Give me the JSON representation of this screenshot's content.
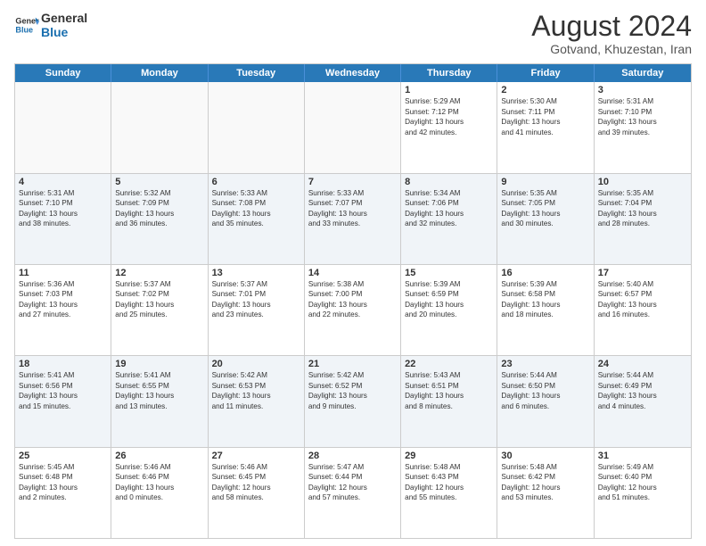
{
  "logo": {
    "line1": "General",
    "line2": "Blue"
  },
  "title": "August 2024",
  "location": "Gotvand, Khuzestan, Iran",
  "days": [
    "Sunday",
    "Monday",
    "Tuesday",
    "Wednesday",
    "Thursday",
    "Friday",
    "Saturday"
  ],
  "rows": [
    [
      {
        "day": "",
        "text": ""
      },
      {
        "day": "",
        "text": ""
      },
      {
        "day": "",
        "text": ""
      },
      {
        "day": "",
        "text": ""
      },
      {
        "day": "1",
        "text": "Sunrise: 5:29 AM\nSunset: 7:12 PM\nDaylight: 13 hours\nand 42 minutes."
      },
      {
        "day": "2",
        "text": "Sunrise: 5:30 AM\nSunset: 7:11 PM\nDaylight: 13 hours\nand 41 minutes."
      },
      {
        "day": "3",
        "text": "Sunrise: 5:31 AM\nSunset: 7:10 PM\nDaylight: 13 hours\nand 39 minutes."
      }
    ],
    [
      {
        "day": "4",
        "text": "Sunrise: 5:31 AM\nSunset: 7:10 PM\nDaylight: 13 hours\nand 38 minutes."
      },
      {
        "day": "5",
        "text": "Sunrise: 5:32 AM\nSunset: 7:09 PM\nDaylight: 13 hours\nand 36 minutes."
      },
      {
        "day": "6",
        "text": "Sunrise: 5:33 AM\nSunset: 7:08 PM\nDaylight: 13 hours\nand 35 minutes."
      },
      {
        "day": "7",
        "text": "Sunrise: 5:33 AM\nSunset: 7:07 PM\nDaylight: 13 hours\nand 33 minutes."
      },
      {
        "day": "8",
        "text": "Sunrise: 5:34 AM\nSunset: 7:06 PM\nDaylight: 13 hours\nand 32 minutes."
      },
      {
        "day": "9",
        "text": "Sunrise: 5:35 AM\nSunset: 7:05 PM\nDaylight: 13 hours\nand 30 minutes."
      },
      {
        "day": "10",
        "text": "Sunrise: 5:35 AM\nSunset: 7:04 PM\nDaylight: 13 hours\nand 28 minutes."
      }
    ],
    [
      {
        "day": "11",
        "text": "Sunrise: 5:36 AM\nSunset: 7:03 PM\nDaylight: 13 hours\nand 27 minutes."
      },
      {
        "day": "12",
        "text": "Sunrise: 5:37 AM\nSunset: 7:02 PM\nDaylight: 13 hours\nand 25 minutes."
      },
      {
        "day": "13",
        "text": "Sunrise: 5:37 AM\nSunset: 7:01 PM\nDaylight: 13 hours\nand 23 minutes."
      },
      {
        "day": "14",
        "text": "Sunrise: 5:38 AM\nSunset: 7:00 PM\nDaylight: 13 hours\nand 22 minutes."
      },
      {
        "day": "15",
        "text": "Sunrise: 5:39 AM\nSunset: 6:59 PM\nDaylight: 13 hours\nand 20 minutes."
      },
      {
        "day": "16",
        "text": "Sunrise: 5:39 AM\nSunset: 6:58 PM\nDaylight: 13 hours\nand 18 minutes."
      },
      {
        "day": "17",
        "text": "Sunrise: 5:40 AM\nSunset: 6:57 PM\nDaylight: 13 hours\nand 16 minutes."
      }
    ],
    [
      {
        "day": "18",
        "text": "Sunrise: 5:41 AM\nSunset: 6:56 PM\nDaylight: 13 hours\nand 15 minutes."
      },
      {
        "day": "19",
        "text": "Sunrise: 5:41 AM\nSunset: 6:55 PM\nDaylight: 13 hours\nand 13 minutes."
      },
      {
        "day": "20",
        "text": "Sunrise: 5:42 AM\nSunset: 6:53 PM\nDaylight: 13 hours\nand 11 minutes."
      },
      {
        "day": "21",
        "text": "Sunrise: 5:42 AM\nSunset: 6:52 PM\nDaylight: 13 hours\nand 9 minutes."
      },
      {
        "day": "22",
        "text": "Sunrise: 5:43 AM\nSunset: 6:51 PM\nDaylight: 13 hours\nand 8 minutes."
      },
      {
        "day": "23",
        "text": "Sunrise: 5:44 AM\nSunset: 6:50 PM\nDaylight: 13 hours\nand 6 minutes."
      },
      {
        "day": "24",
        "text": "Sunrise: 5:44 AM\nSunset: 6:49 PM\nDaylight: 13 hours\nand 4 minutes."
      }
    ],
    [
      {
        "day": "25",
        "text": "Sunrise: 5:45 AM\nSunset: 6:48 PM\nDaylight: 13 hours\nand 2 minutes."
      },
      {
        "day": "26",
        "text": "Sunrise: 5:46 AM\nSunset: 6:46 PM\nDaylight: 13 hours\nand 0 minutes."
      },
      {
        "day": "27",
        "text": "Sunrise: 5:46 AM\nSunset: 6:45 PM\nDaylight: 12 hours\nand 58 minutes."
      },
      {
        "day": "28",
        "text": "Sunrise: 5:47 AM\nSunset: 6:44 PM\nDaylight: 12 hours\nand 57 minutes."
      },
      {
        "day": "29",
        "text": "Sunrise: 5:48 AM\nSunset: 6:43 PM\nDaylight: 12 hours\nand 55 minutes."
      },
      {
        "day": "30",
        "text": "Sunrise: 5:48 AM\nSunset: 6:42 PM\nDaylight: 12 hours\nand 53 minutes."
      },
      {
        "day": "31",
        "text": "Sunrise: 5:49 AM\nSunset: 6:40 PM\nDaylight: 12 hours\nand 51 minutes."
      }
    ]
  ]
}
